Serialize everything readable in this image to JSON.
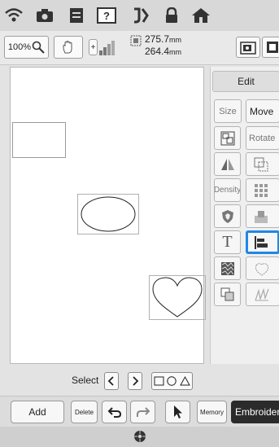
{
  "toolbar": {
    "zoom_label": "100%",
    "size_width": "275.7",
    "size_height": "264.4",
    "unit": "mm"
  },
  "panel": {
    "edit_tab": "Edit",
    "size": "Size",
    "move": "Move",
    "rotate": "Rotate",
    "density": "Density"
  },
  "select_row": {
    "label": "Select"
  },
  "bottom": {
    "add": "Add",
    "delete": "Delete",
    "memory": "Memory",
    "embroidery": "Embroidery"
  },
  "colors": {
    "accent": "#1e88e5",
    "dark_button": "#2b2b2b"
  }
}
